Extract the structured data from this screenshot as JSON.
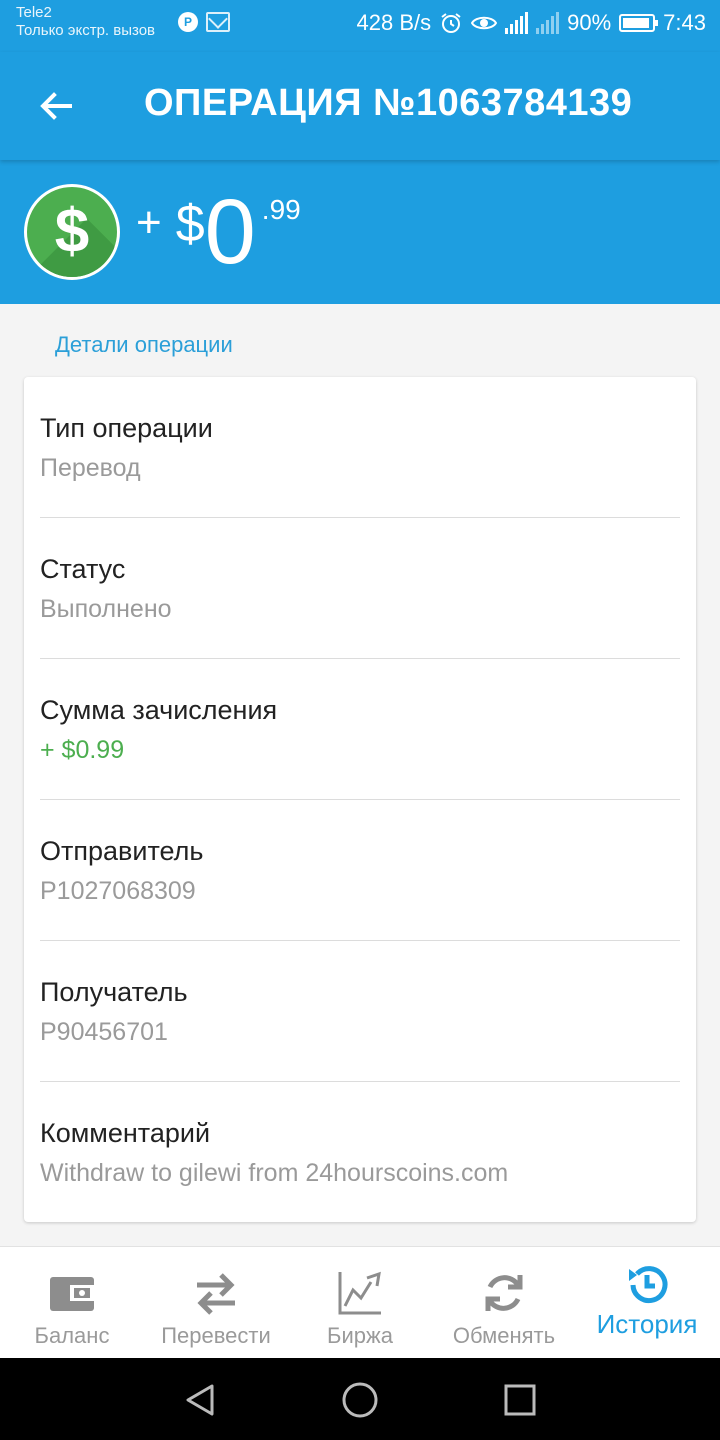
{
  "status_bar": {
    "carrier": "Tele2",
    "carrier_note": "Только экстр. вызов",
    "net_speed": "428 B/s",
    "battery": "90%",
    "time": "7:43",
    "icons": [
      "p-icon",
      "mail-icon",
      "alarm-icon",
      "eye-icon",
      "signal-4g-icon",
      "signal-icon",
      "battery-icon"
    ]
  },
  "app_bar": {
    "title": "ОПЕРАЦИЯ №1063784139",
    "back_icon": "arrow-left-icon"
  },
  "hero": {
    "coin_symbol": "$",
    "sign": "+",
    "currency": "$",
    "integer": "0",
    "decimal": ".99"
  },
  "details": {
    "section_title": "Детали операции",
    "rows": [
      {
        "label": "Тип операции",
        "value": "Перевод"
      },
      {
        "label": "Статус",
        "value": "Выполнено"
      },
      {
        "label": "Сумма зачисления",
        "value": "+ $0.99"
      },
      {
        "label": "Отправитель",
        "value": "P1027068309"
      },
      {
        "label": "Получатель",
        "value": "P90456701"
      },
      {
        "label": "Комментарий",
        "value": "Withdraw to gilewi from 24hourscoins.com"
      }
    ]
  },
  "bottom_nav": {
    "items": [
      {
        "label": "Баланс",
        "icon": "wallet-icon"
      },
      {
        "label": "Перевести",
        "icon": "transfer-icon"
      },
      {
        "label": "Биржа",
        "icon": "chart-icon"
      },
      {
        "label": "Обменять",
        "icon": "exchange-icon"
      },
      {
        "label": "История",
        "icon": "history-icon"
      }
    ],
    "active": "История"
  },
  "colors": {
    "primary": "#1e9ee0",
    "green": "#4cae4f",
    "label": "#222222",
    "value": "#9a9a9a",
    "nav_inactive": "#9a9a9a"
  }
}
